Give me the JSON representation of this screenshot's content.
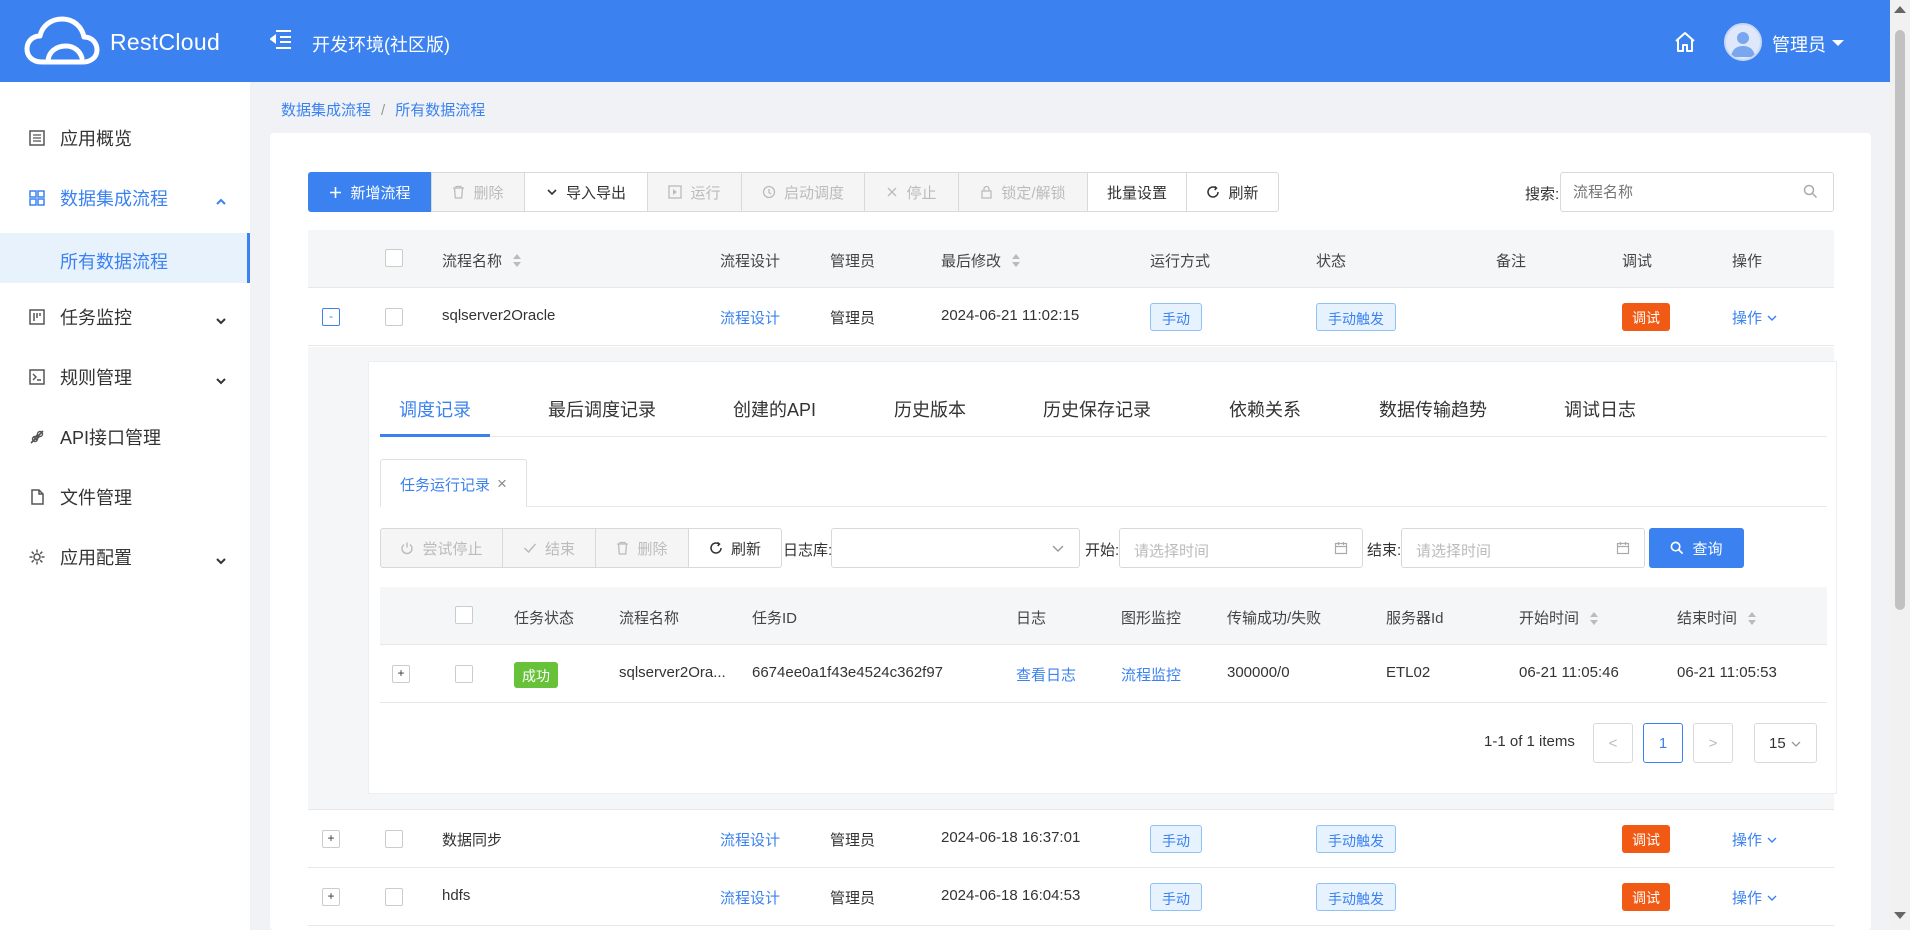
{
  "header": {
    "brand": "RestCloud",
    "env_title": "开发环境(社区版)",
    "user_name": "管理员"
  },
  "sidebar": {
    "items": [
      {
        "label": "应用概览",
        "icon": "list-icon"
      },
      {
        "label": "数据集成流程",
        "icon": "grid-icon",
        "expanded": true
      },
      {
        "label": "任务监控",
        "icon": "monitor-icon"
      },
      {
        "label": "规则管理",
        "icon": "terminal-icon"
      },
      {
        "label": "API接口管理",
        "icon": "api-icon"
      },
      {
        "label": "文件管理",
        "icon": "file-icon"
      },
      {
        "label": "应用配置",
        "icon": "gear-icon"
      }
    ],
    "sub_item": "所有数据流程"
  },
  "breadcrumb": {
    "parent": "数据集成流程",
    "separator": "/",
    "current": "所有数据流程"
  },
  "toolbar": {
    "add": "新增流程",
    "delete": "删除",
    "import_export": "导入导出",
    "run": "运行",
    "schedule": "启动调度",
    "stop": "停止",
    "lock": "锁定/解锁",
    "batch": "批量设置",
    "refresh": "刷新",
    "search_label": "搜索:",
    "search_placeholder": "流程名称"
  },
  "table": {
    "headers": {
      "name": "流程名称",
      "design": "流程设计",
      "admin": "管理员",
      "modified": "最后修改",
      "run_mode": "运行方式",
      "status": "状态",
      "remark": "备注",
      "debug": "调试",
      "action": "操作"
    },
    "rows": [
      {
        "expand": "-",
        "name": "sqlserver2Oracle",
        "design": "流程设计",
        "admin": "管理员",
        "modified": "2024-06-21 11:02:15",
        "run_mode": "手动",
        "status": "手动触发",
        "debug": "调试",
        "action": "操作"
      },
      {
        "expand": "+",
        "name": "数据同步",
        "design": "流程设计",
        "admin": "管理员",
        "modified": "2024-06-18 16:37:01",
        "run_mode": "手动",
        "status": "手动触发",
        "debug": "调试",
        "action": "操作"
      },
      {
        "expand": "+",
        "name": "hdfs",
        "design": "流程设计",
        "admin": "管理员",
        "modified": "2024-06-18 16:04:53",
        "run_mode": "手动",
        "status": "手动触发",
        "debug": "调试",
        "action": "操作"
      }
    ]
  },
  "detail": {
    "tabs": [
      "调度记录",
      "最后调度记录",
      "创建的API",
      "历史版本",
      "历史保存记录",
      "依赖关系",
      "数据传输趋势",
      "调试日志"
    ],
    "subtab": "任务运行记录",
    "subtab_close": "×",
    "toolbar": {
      "try_stop": "尝试停止",
      "finish": "结束",
      "delete": "删除",
      "refresh": "刷新",
      "log_db_label": "日志库:",
      "start_label": "开始:",
      "start_placeholder": "请选择时间",
      "end_label": "结束:",
      "end_placeholder": "请选择时间",
      "query": "查询"
    },
    "headers": {
      "task_status": "任务状态",
      "flow_name": "流程名称",
      "task_id": "任务ID",
      "log": "日志",
      "graph": "图形监控",
      "transfer": "传输成功/失败",
      "server": "服务器Id",
      "start": "开始时间",
      "end": "结束时间"
    },
    "row": {
      "expand": "+",
      "task_status": "成功",
      "flow_name": "sqlserver2Ora...",
      "task_id": "6674ee0a1f43e4524c362f97",
      "log": "查看日志",
      "graph": "流程监控",
      "transfer": "300000/0",
      "server": "ETL02",
      "start": "06-21 11:05:46",
      "end": "06-21 11:05:53"
    },
    "pagination": {
      "info": "1-1 of 1 items",
      "prev": "<",
      "page": "1",
      "next": ">",
      "size": "15"
    }
  },
  "colors": {
    "primary": "#3b82f0",
    "debug_tag": "#f05a14",
    "success_tag": "#67c23a"
  }
}
